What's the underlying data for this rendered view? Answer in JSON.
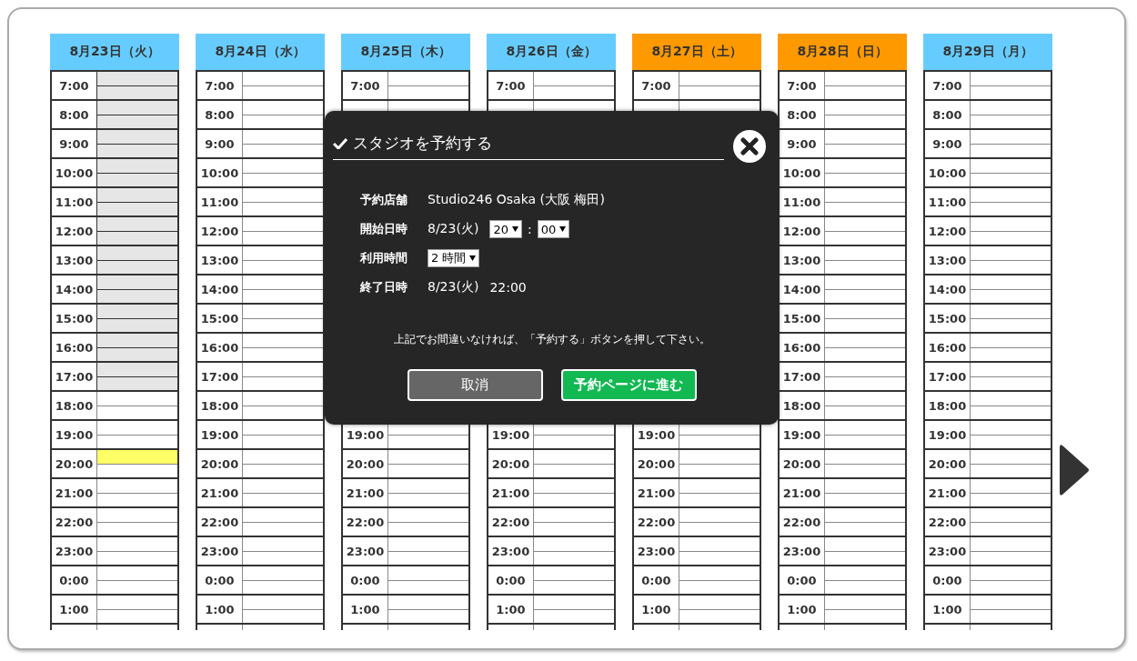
{
  "days": [
    {
      "label": "8月23日（火）",
      "color": "#66ccff",
      "hours": [
        {
          "time": "7:00",
          "slots": [
            {
              "busy": true,
              "selected": false
            },
            {
              "busy": true,
              "selected": false
            }
          ]
        },
        {
          "time": "8:00",
          "slots": [
            {
              "busy": true,
              "selected": false
            },
            {
              "busy": true,
              "selected": false
            }
          ]
        },
        {
          "time": "9:00",
          "slots": [
            {
              "busy": true,
              "selected": false
            },
            {
              "busy": true,
              "selected": false
            }
          ]
        },
        {
          "time": "10:00",
          "slots": [
            {
              "busy": true,
              "selected": false
            },
            {
              "busy": true,
              "selected": false
            }
          ]
        },
        {
          "time": "11:00",
          "slots": [
            {
              "busy": true,
              "selected": false
            },
            {
              "busy": true,
              "selected": false
            }
          ]
        },
        {
          "time": "12:00",
          "slots": [
            {
              "busy": true,
              "selected": false
            },
            {
              "busy": true,
              "selected": false
            }
          ]
        },
        {
          "time": "13:00",
          "slots": [
            {
              "busy": true,
              "selected": false
            },
            {
              "busy": true,
              "selected": false
            }
          ]
        },
        {
          "time": "14:00",
          "slots": [
            {
              "busy": true,
              "selected": false
            },
            {
              "busy": true,
              "selected": false
            }
          ]
        },
        {
          "time": "15:00",
          "slots": [
            {
              "busy": true,
              "selected": false
            },
            {
              "busy": true,
              "selected": false
            }
          ]
        },
        {
          "time": "16:00",
          "slots": [
            {
              "busy": true,
              "selected": false
            },
            {
              "busy": true,
              "selected": false
            }
          ]
        },
        {
          "time": "17:00",
          "slots": [
            {
              "busy": true,
              "selected": false
            },
            {
              "busy": true,
              "selected": false
            }
          ]
        },
        {
          "time": "18:00",
          "slots": [
            {
              "busy": false,
              "selected": false
            },
            {
              "busy": false,
              "selected": false
            }
          ]
        },
        {
          "time": "19:00",
          "slots": [
            {
              "busy": false,
              "selected": false
            },
            {
              "busy": false,
              "selected": false
            }
          ]
        },
        {
          "time": "20:00",
          "slots": [
            {
              "busy": false,
              "selected": true
            },
            {
              "busy": false,
              "selected": false
            }
          ]
        },
        {
          "time": "21:00",
          "slots": [
            {
              "busy": false,
              "selected": false
            },
            {
              "busy": false,
              "selected": false
            }
          ]
        },
        {
          "time": "22:00",
          "slots": [
            {
              "busy": false,
              "selected": false
            },
            {
              "busy": false,
              "selected": false
            }
          ]
        },
        {
          "time": "23:00",
          "slots": [
            {
              "busy": false,
              "selected": false
            },
            {
              "busy": false,
              "selected": false
            }
          ]
        },
        {
          "time": "0:00",
          "slots": [
            {
              "busy": false,
              "selected": false
            },
            {
              "busy": false,
              "selected": false
            }
          ]
        },
        {
          "time": "1:00",
          "slots": [
            {
              "busy": false,
              "selected": false
            },
            {
              "busy": false,
              "selected": false
            }
          ]
        }
      ]
    },
    {
      "label": "8月24日（水）",
      "color": "#66ccff",
      "hours": [
        {
          "time": "7:00"
        },
        {
          "time": "8:00"
        },
        {
          "time": "9:00"
        },
        {
          "time": "10:00"
        },
        {
          "time": "11:00"
        },
        {
          "time": "12:00"
        },
        {
          "time": "13:00"
        },
        {
          "time": "14:00"
        },
        {
          "time": "15:00"
        },
        {
          "time": "16:00"
        },
        {
          "time": "17:00"
        },
        {
          "time": "18:00"
        },
        {
          "time": "19:00"
        },
        {
          "time": "20:00"
        },
        {
          "time": "21:00"
        },
        {
          "time": "22:00"
        },
        {
          "time": "23:00"
        },
        {
          "time": "0:00"
        },
        {
          "time": "1:00"
        }
      ]
    },
    {
      "label": "8月25日（木）",
      "color": "#66ccff",
      "hours": [
        {
          "time": "7:00"
        },
        {
          "time": "19:00"
        },
        {
          "time": "20:00"
        },
        {
          "time": "21:00"
        },
        {
          "time": "22:00"
        },
        {
          "time": "23:00"
        },
        {
          "time": "0:00"
        },
        {
          "time": "1:00"
        }
      ]
    },
    {
      "label": "8月26日（金）",
      "color": "#66ccff",
      "hours": [
        {
          "time": "7:00"
        },
        {
          "time": "19:00"
        },
        {
          "time": "20:00"
        },
        {
          "time": "21:00"
        },
        {
          "time": "22:00"
        },
        {
          "time": "23:00"
        },
        {
          "time": "0:00"
        },
        {
          "time": "1:00"
        }
      ]
    },
    {
      "label": "8月27日（土）",
      "color": "#ff9900",
      "hours": [
        {
          "time": "7:00"
        },
        {
          "time": "19:00"
        },
        {
          "time": "20:00"
        },
        {
          "time": "21:00"
        },
        {
          "time": "22:00"
        },
        {
          "time": "23:00"
        },
        {
          "time": "0:00"
        },
        {
          "time": "1:00"
        }
      ]
    },
    {
      "label": "8月28日（日）",
      "color": "#ff9900",
      "hours": [
        {
          "time": "7:00"
        },
        {
          "time": "8:00"
        },
        {
          "time": "9:00"
        },
        {
          "time": "10:00"
        },
        {
          "time": "11:00"
        },
        {
          "time": "12:00"
        },
        {
          "time": "13:00"
        },
        {
          "time": "14:00"
        },
        {
          "time": "15:00"
        },
        {
          "time": "16:00"
        },
        {
          "time": "17:00"
        },
        {
          "time": "18:00"
        },
        {
          "time": "19:00"
        },
        {
          "time": "20:00"
        },
        {
          "time": "21:00"
        },
        {
          "time": "22:00"
        },
        {
          "time": "23:00"
        },
        {
          "time": "0:00"
        },
        {
          "time": "1:00"
        }
      ]
    },
    {
      "label": "8月29日（月）",
      "color": "#66ccff",
      "hours": [
        {
          "time": "7:00"
        },
        {
          "time": "8:00"
        },
        {
          "time": "9:00"
        },
        {
          "time": "10:00"
        },
        {
          "time": "11:00"
        },
        {
          "time": "12:00"
        },
        {
          "time": "13:00"
        },
        {
          "time": "14:00"
        },
        {
          "time": "15:00"
        },
        {
          "time": "16:00"
        },
        {
          "time": "17:00"
        },
        {
          "time": "18:00"
        },
        {
          "time": "19:00"
        },
        {
          "time": "20:00"
        },
        {
          "time": "21:00"
        },
        {
          "time": "22:00"
        },
        {
          "time": "23:00"
        },
        {
          "time": "0:00"
        },
        {
          "time": "1:00"
        }
      ]
    }
  ],
  "dialog": {
    "title": "スタジオを予約する",
    "fields": [
      {
        "label": "予約店舗",
        "items": [
          {
            "kind": "text",
            "text": "Studio246 Osaka (大阪 梅田)"
          }
        ]
      },
      {
        "label": "開始日時",
        "items": [
          {
            "kind": "text",
            "text": "8/23(火)"
          },
          {
            "kind": "select",
            "text": "20"
          },
          {
            "kind": "text",
            "text": ":"
          },
          {
            "kind": "select",
            "text": "00"
          }
        ]
      },
      {
        "label": "利用時間",
        "items": [
          {
            "kind": "select",
            "text": "2 時間"
          }
        ]
      },
      {
        "label": "終了日時",
        "items": [
          {
            "kind": "text",
            "text": "8/23(火)"
          },
          {
            "kind": "text",
            "text": "22:00"
          }
        ]
      }
    ],
    "note": "上記でお間違いなければ、「予約する」ボタンを押して下さい。",
    "buttons": [
      {
        "label": "取消",
        "kind": "cancel"
      },
      {
        "label": "予約ページに進む",
        "kind": "primary"
      }
    ]
  }
}
